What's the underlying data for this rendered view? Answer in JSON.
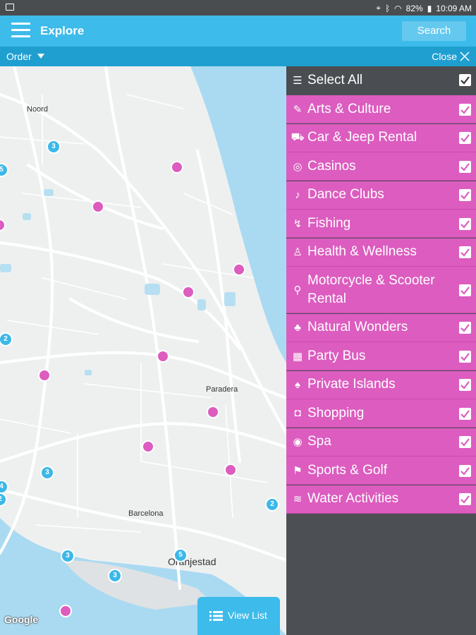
{
  "status_bar": {
    "battery": "82%",
    "time": "10:09 AM"
  },
  "app_bar": {
    "title": "Explore",
    "search_label": "Search"
  },
  "sub_bar": {
    "order_label": "Order",
    "close_label": "Close"
  },
  "map": {
    "labels": [
      "Noord",
      "Paradera",
      "Barcelona",
      "Oranjestad"
    ],
    "google": "Google",
    "clusters": [
      "3",
      "5",
      "2",
      "2",
      "3",
      "4",
      "2",
      "3",
      "3",
      "5"
    ],
    "view_list_label": "View List"
  },
  "filters": {
    "select_all": "Select All",
    "items": [
      {
        "label": "Arts & Culture",
        "icon": "palette-icon",
        "glyph": "✎"
      },
      {
        "label": "Car & Jeep Rental",
        "icon": "car-icon",
        "glyph": "⛟"
      },
      {
        "label": "Casinos",
        "icon": "chip-icon",
        "glyph": "◎"
      },
      {
        "label": "Dance Clubs",
        "icon": "dancer-icon",
        "glyph": "♪"
      },
      {
        "label": "Fishing",
        "icon": "fisher-icon",
        "glyph": "↯"
      },
      {
        "label": "Health & Wellness",
        "icon": "meditation-icon",
        "glyph": "♙"
      },
      {
        "label": "Motorcycle & Scooter Rental",
        "icon": "scooter-icon",
        "glyph": "⚲"
      },
      {
        "label": "Natural Wonders",
        "icon": "sprout-icon",
        "glyph": "♣"
      },
      {
        "label": "Party Bus",
        "icon": "bus-icon",
        "glyph": "▦"
      },
      {
        "label": "Private Islands",
        "icon": "palm-icon",
        "glyph": "♠"
      },
      {
        "label": "Shopping",
        "icon": "bag-icon",
        "glyph": "◘"
      },
      {
        "label": "Spa",
        "icon": "spa-icon",
        "glyph": "◉"
      },
      {
        "label": "Sports & Golf",
        "icon": "golfer-icon",
        "glyph": "⚑"
      },
      {
        "label": "Water Activities",
        "icon": "waves-icon",
        "glyph": "≋"
      }
    ]
  },
  "colors": {
    "app_bar": "#3dbbea",
    "sub_bar": "#1f9fd0",
    "filter_pink": "#dc5cbf",
    "panel_dark": "#4c4f53"
  }
}
